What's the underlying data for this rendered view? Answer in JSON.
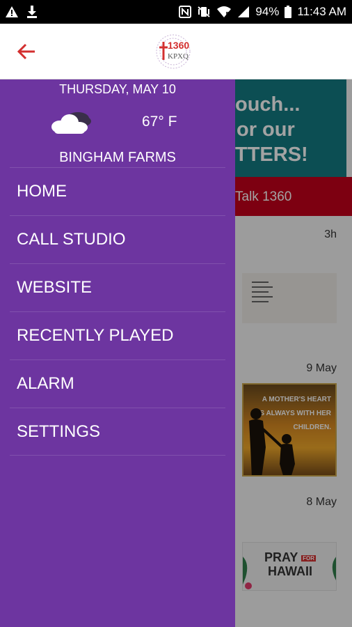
{
  "status_bar": {
    "battery_pct": "94%",
    "time": "11:43 AM",
    "icons": [
      "warning-icon",
      "download-icon",
      "nfc-icon",
      "vibrate-icon",
      "wifi-icon",
      "signal-icon",
      "battery-icon"
    ]
  },
  "app_bar": {
    "back_icon": "arrow-left-icon",
    "logo_number": "1360",
    "logo_letters": "KPXQ",
    "accent_color": "#d32f2f"
  },
  "drawer": {
    "date": "THURSDAY, MAY 10",
    "weather_icon": "cloud-icon",
    "temperature": "67° F",
    "location": "BINGHAM FARMS",
    "background_color": "#6d35a0",
    "items": [
      {
        "label": "HOME"
      },
      {
        "label": "CALL STUDIO"
      },
      {
        "label": "WEBSITE"
      },
      {
        "label": "RECENTLY PLAYED"
      },
      {
        "label": "ALARM"
      },
      {
        "label": "SETTINGS"
      }
    ]
  },
  "background": {
    "banner_lines": [
      "ouch...",
      "or our",
      "TTERS!"
    ],
    "red_bar_text": "Talk 1360",
    "feed": [
      {
        "time": "3h"
      },
      {
        "time": "9 May",
        "image_text": "A MOTHER'S HEART IS ALWAYS WITH HER CHILDREN."
      },
      {
        "time": "8 May",
        "image_text_1": "PRAY",
        "image_text_2": "FOR",
        "image_text_3": "HAWAII"
      }
    ]
  }
}
